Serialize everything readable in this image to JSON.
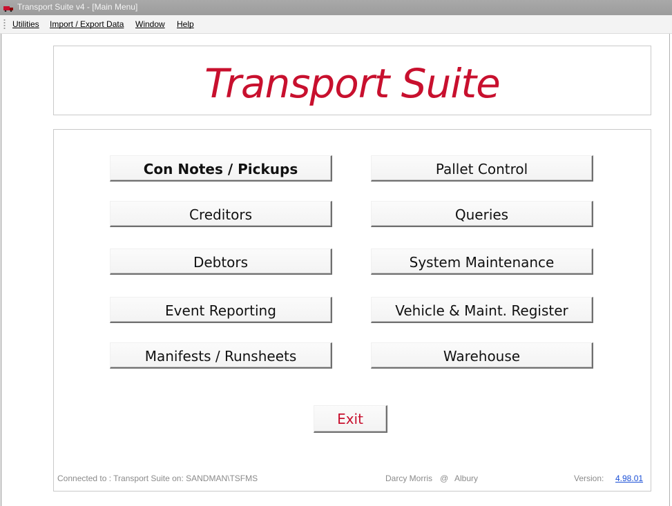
{
  "window": {
    "title": "Transport Suite v4 - [Main Menu]",
    "icon": "truck-icon"
  },
  "menubar": {
    "items": [
      {
        "label": "Utilities"
      },
      {
        "label": "Import / Export Data"
      },
      {
        "label": "Window"
      },
      {
        "label": "Help"
      }
    ]
  },
  "header": {
    "logo_text": "Transport Suite",
    "logo_color": "#c8102e"
  },
  "menu_buttons": {
    "left": [
      {
        "label": "Con Notes / Pickups"
      },
      {
        "label": "Creditors"
      },
      {
        "label": "Debtors"
      },
      {
        "label": "Event Reporting"
      },
      {
        "label": "Manifests / Runsheets"
      }
    ],
    "right": [
      {
        "label": "Pallet Control"
      },
      {
        "label": "Queries"
      },
      {
        "label": "System Maintenance"
      },
      {
        "label": "Vehicle & Maint. Register"
      },
      {
        "label": "Warehouse"
      }
    ]
  },
  "exit_button": {
    "label": "Exit",
    "color": "#c8102e"
  },
  "status": {
    "connection": "Connected to : Transport Suite on: SANDMAN\\TSFMS",
    "user": "Darcy Morris",
    "at": "@",
    "location": "Albury",
    "version_label": "Version:",
    "version": "4.98.01"
  }
}
